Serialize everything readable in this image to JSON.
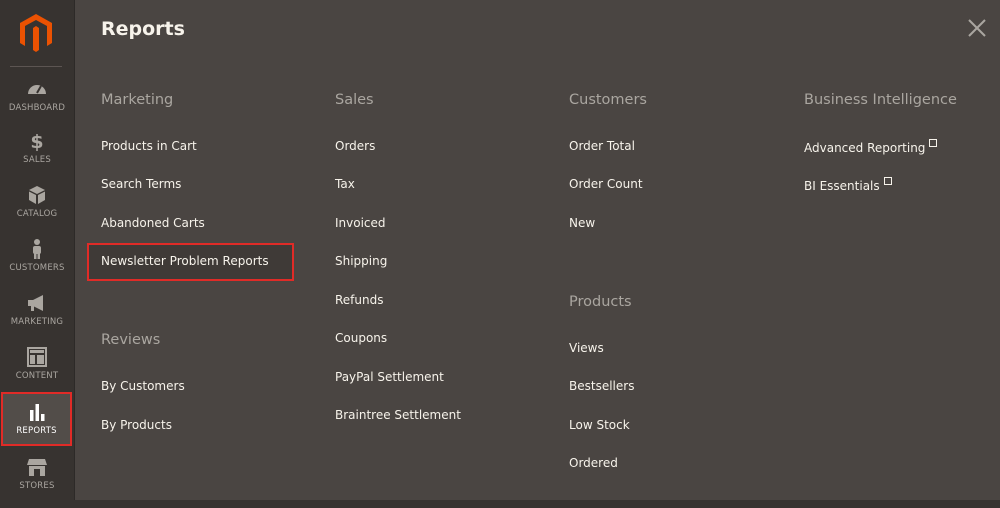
{
  "sidebar": {
    "items": [
      {
        "label": "DASHBOARD",
        "icon": "dashboard-icon"
      },
      {
        "label": "SALES",
        "icon": "dollar-icon"
      },
      {
        "label": "CATALOG",
        "icon": "box-icon"
      },
      {
        "label": "CUSTOMERS",
        "icon": "person-icon"
      },
      {
        "label": "MARKETING",
        "icon": "megaphone-icon"
      },
      {
        "label": "CONTENT",
        "icon": "layout-icon"
      },
      {
        "label": "REPORTS",
        "icon": "bar-chart-icon",
        "active": true
      },
      {
        "label": "STORES",
        "icon": "storefront-icon"
      }
    ]
  },
  "panel": {
    "title": "Reports",
    "columns": [
      {
        "groups": [
          {
            "title": "Marketing",
            "links": [
              "Products in Cart",
              "Search Terms",
              "Abandoned Carts",
              "Newsletter Problem Reports"
            ]
          },
          {
            "title": "Reviews",
            "links": [
              "By Customers",
              "By Products"
            ]
          }
        ]
      },
      {
        "groups": [
          {
            "title": "Sales",
            "links": [
              "Orders",
              "Tax",
              "Invoiced",
              "Shipping",
              "Refunds",
              "Coupons",
              "PayPal Settlement",
              "Braintree Settlement"
            ]
          }
        ]
      },
      {
        "groups": [
          {
            "title": "Customers",
            "links": [
              "Order Total",
              "Order Count",
              "New"
            ]
          },
          {
            "title": "Products",
            "links": [
              "Views",
              "Bestsellers",
              "Low Stock",
              "Ordered"
            ]
          }
        ]
      },
      {
        "groups": [
          {
            "title": "Business Intelligence",
            "links": [
              "Advanced Reporting",
              "BI Essentials"
            ]
          }
        ]
      }
    ]
  },
  "colors": {
    "sidebar_bg": "#373330",
    "panel_bg": "#4a4542",
    "accent_orange": "#eb5202",
    "highlight_red": "#e02b27"
  }
}
